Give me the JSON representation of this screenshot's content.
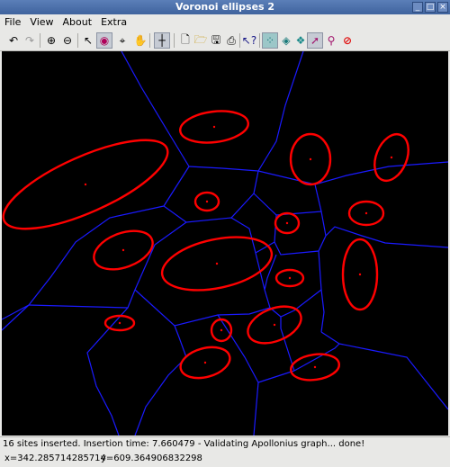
{
  "window": {
    "title": "Voronoi ellipses 2"
  },
  "menu": {
    "items": [
      "File",
      "View",
      "About",
      "Extra"
    ]
  },
  "toolbar": {
    "tools": [
      "undo-icon",
      "redo-icon",
      "zoom-in-icon",
      "zoom-out-icon",
      "pointer-icon",
      "insert-ellipse-icon",
      "target-icon",
      "hand-icon",
      "crosshair-icon",
      "new-file-icon",
      "open-folder-icon",
      "save-icon",
      "print-icon",
      "help-pointer-icon",
      "show-points-icon",
      "show-delaunay-icon",
      "show-voronoi-icon",
      "insert-point-icon",
      "inspect-icon",
      "delete-icon"
    ]
  },
  "colors": {
    "background": "#000000",
    "edges": "#1a1aff",
    "ellipses": "#ff0000",
    "centers": "#ff0000"
  },
  "status": {
    "message": "16 sites inserted. Insertion time: 7.660479 - Validating Apollonius graph... done!",
    "x": "x=342.285714285714",
    "y": "y=609.364906832298"
  }
}
